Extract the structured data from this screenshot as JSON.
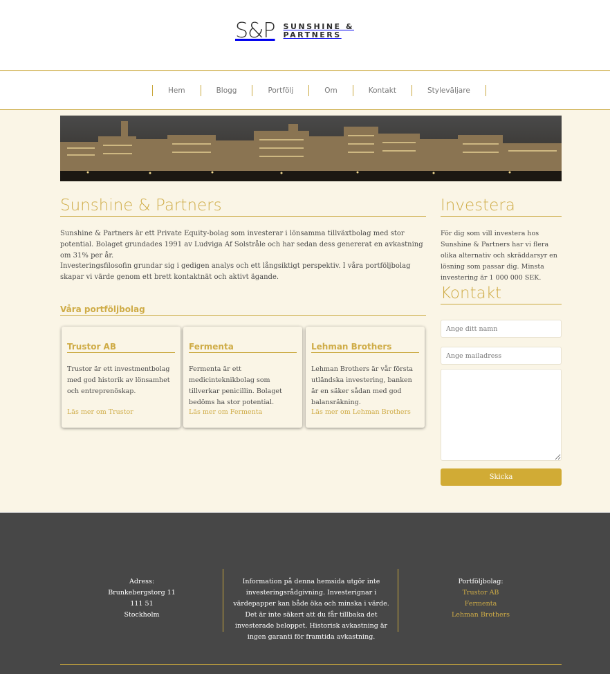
{
  "brand": {
    "mark": "S&P",
    "name_line1": "SUNSHINE &",
    "name_line2": "PARTNERS",
    "colors": {
      "accent": "#cfac47",
      "button": "#d1ab35",
      "footer": "#474747",
      "background": "#faf5e6"
    }
  },
  "nav": {
    "items": [
      {
        "label": "Hem"
      },
      {
        "label": "Blogg"
      },
      {
        "label": "Portfölj"
      },
      {
        "label": "Om"
      },
      {
        "label": "Kontakt"
      },
      {
        "label": "Styleväljare"
      }
    ]
  },
  "main": {
    "title": "Sunshine & Partners",
    "paragraph1": "Sunshine & Partners är ett Private Equity-bolag som investerar i lönsamma tillväxtbolag med stor potential. Bolaget grundades 1991 av Ludviga Af Solstråle och har sedan dess genererat en avkastning om 31% per år.",
    "paragraph2": "Investeringsfilosofin grundar sig i gedigen analys och ett långsiktigt perspektiv. I våra portföljbolag skapar vi värde genom ett brett kontaktnät och aktivt ägande.",
    "portfolio_title": "Våra portföljbolag",
    "cards": [
      {
        "title": "Trustor AB",
        "text": "Trustor är ett investmentbolag med god historik av lönsamhet och entreprenöskap.",
        "link": "Läs mer om Trustor"
      },
      {
        "title": "Fermenta",
        "text": "Fermenta är ett medicinteknikbolag som tillverkar penicillin. Bolaget bedöms ha stor potential.",
        "link": "Läs mer om Fermenta"
      },
      {
        "title": "Lehman Brothers",
        "text": "Lehman Brothers är vår första utländska investering, banken är en säker sådan med god balansräkning.",
        "link": "Läs mer om Lehman Brothers"
      }
    ]
  },
  "sidebar": {
    "invest_title": "Investera",
    "invest_text": "För dig som vill investera hos Sunshine & Partners har vi flera olika alternativ och skräddarsyr en lösning som passar dig. Minsta investering är 1 000 000 SEK.",
    "contact_title": "Kontakt",
    "name_placeholder": "Ange ditt namn",
    "email_placeholder": "Ange mailadress",
    "send_label": "Skicka"
  },
  "footer": {
    "address_label": "Adress:",
    "street": "Brunkebergstorg 11",
    "zip": "111 51",
    "city": "Stockholm",
    "disclaimer": "Information på denna hemsida utgör inte investeringsrådgivning. Investerignar i värdepapper kan både öka och minska i värde. Det är inte säkert att du får tillbaka det investerade beloppet. Historisk avkastning är ingen garanti för framtida avkastning.",
    "portfolio_label": "Portföljbolag:",
    "portfolio_links": [
      {
        "label": "Trustor AB"
      },
      {
        "label": "Fermenta"
      },
      {
        "label": "Lehman Brothers"
      }
    ]
  }
}
